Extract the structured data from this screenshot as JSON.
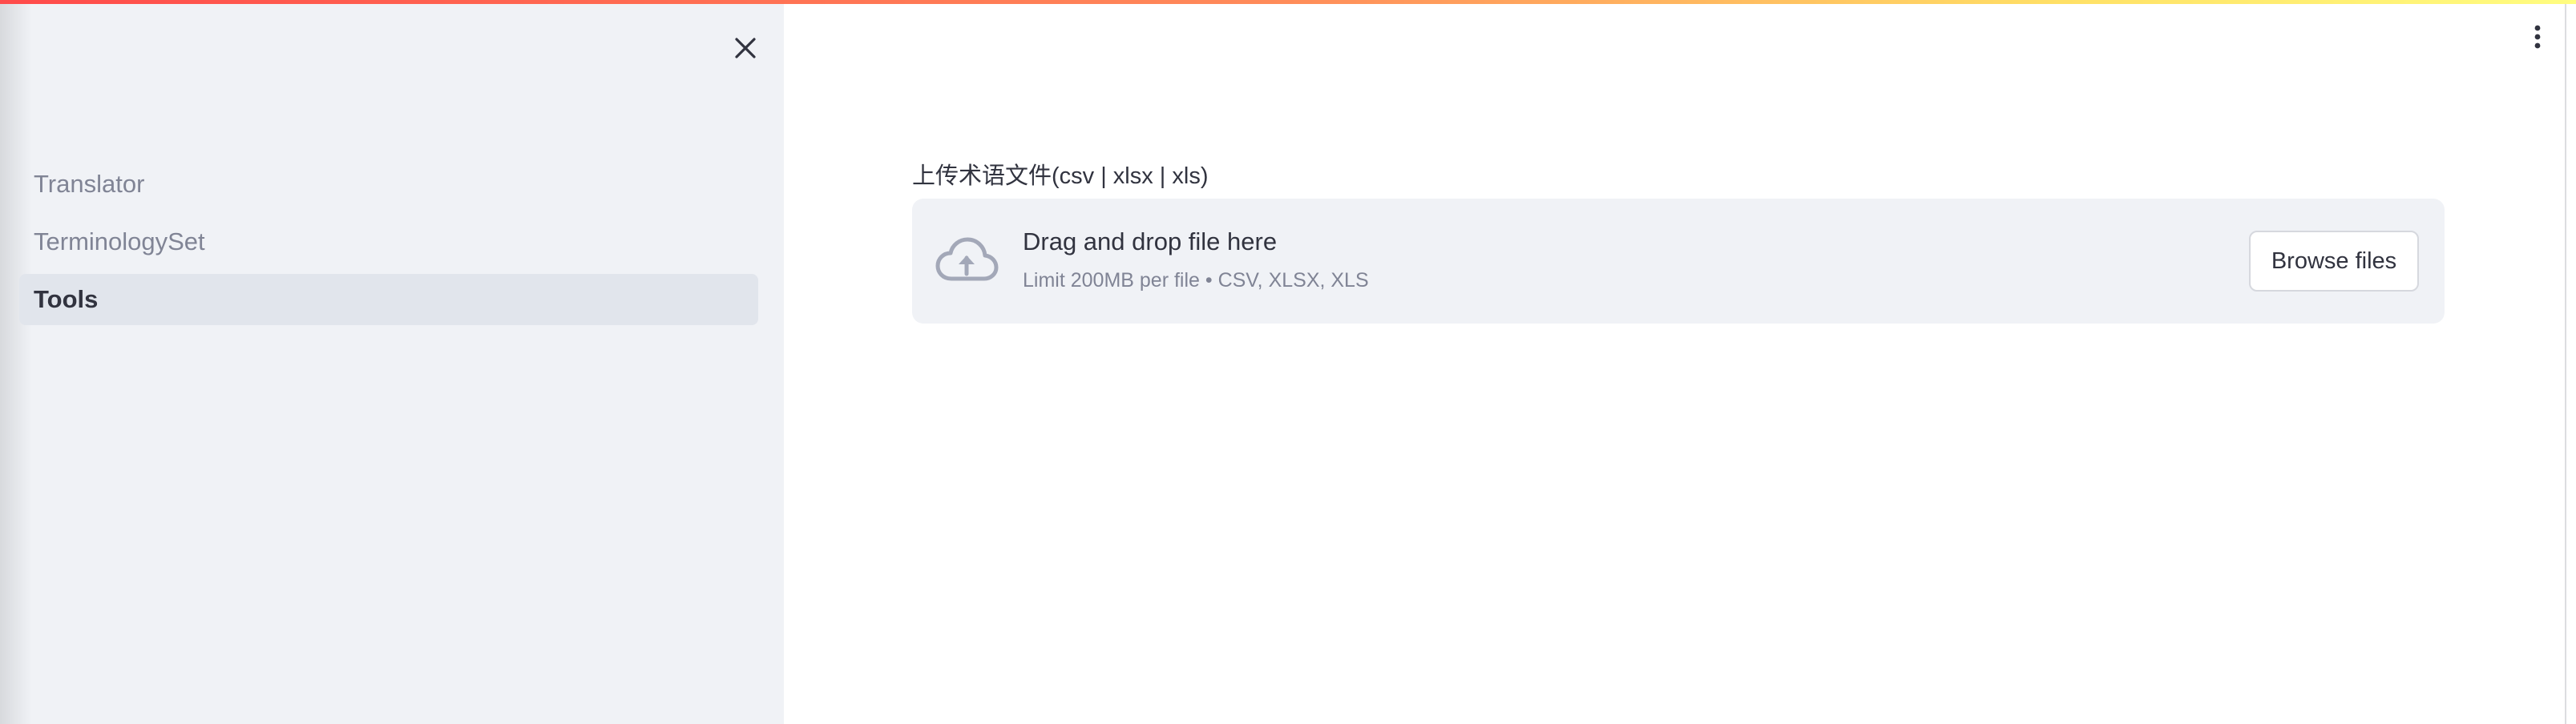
{
  "theme": {
    "sidebar_bg": "#f0f2f6",
    "active_item_bg": "#e1e5ec",
    "text": "#31333f",
    "muted_text": "#808495",
    "dropzone_bg": "#f0f2f6",
    "icon_color": "#a3a8b8"
  },
  "icons": {
    "close": "close-icon",
    "menu": "vertical-ellipsis-icon",
    "upload": "cloud-upload-icon"
  },
  "sidebar": {
    "items": [
      {
        "label": "Translator",
        "active": false
      },
      {
        "label": "TerminologySet",
        "active": false
      },
      {
        "label": "Tools",
        "active": true
      }
    ]
  },
  "main": {
    "uploader": {
      "label": "上传术语文件(csv | xlsx | xls)",
      "title": "Drag and drop file here",
      "limit": "Limit 200MB per file • CSV, XLSX, XLS",
      "button": "Browse files"
    }
  }
}
